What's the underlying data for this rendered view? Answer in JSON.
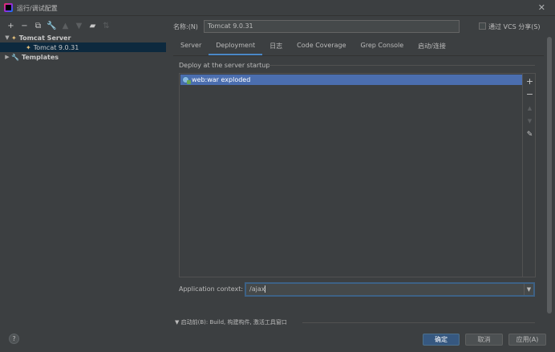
{
  "window": {
    "title": "运行/调试配置",
    "close_icon": "close-icon"
  },
  "toolbar": {
    "icons": [
      "add-icon",
      "remove-icon",
      "copy-icon",
      "wrench-icon",
      "move-up-icon",
      "move-down-icon",
      "folder-icon",
      "sort-icon"
    ]
  },
  "tree": {
    "group_label": "Tomcat Server",
    "child_label": "Tomcat 9.0.31",
    "templates_label": "Templates"
  },
  "config": {
    "name_label": "名称:(N)",
    "name_value": "Tomcat 9.0.31",
    "share_label": "通过 VCS 分享(S)"
  },
  "tabs": [
    "Server",
    "Deployment",
    "日志",
    "Code Coverage",
    "Grep Console",
    "启动/连接"
  ],
  "deployment": {
    "section_title": "Deploy at the server startup",
    "items": [
      "web:war exploded"
    ],
    "context_label": "Application context:",
    "context_value": "/ajax"
  },
  "before_launch": "启动前(B): Build, 构建构件, 激活工具窗口",
  "buttons": {
    "help": "?",
    "ok": "确定",
    "cancel": "取消",
    "apply": "应用(A)"
  },
  "colors": {
    "background": "#3c3f41",
    "selection": "#4b6eaf",
    "tree_selection": "#0d293e",
    "accent": "#4a88c7",
    "primary_button": "#365880"
  }
}
